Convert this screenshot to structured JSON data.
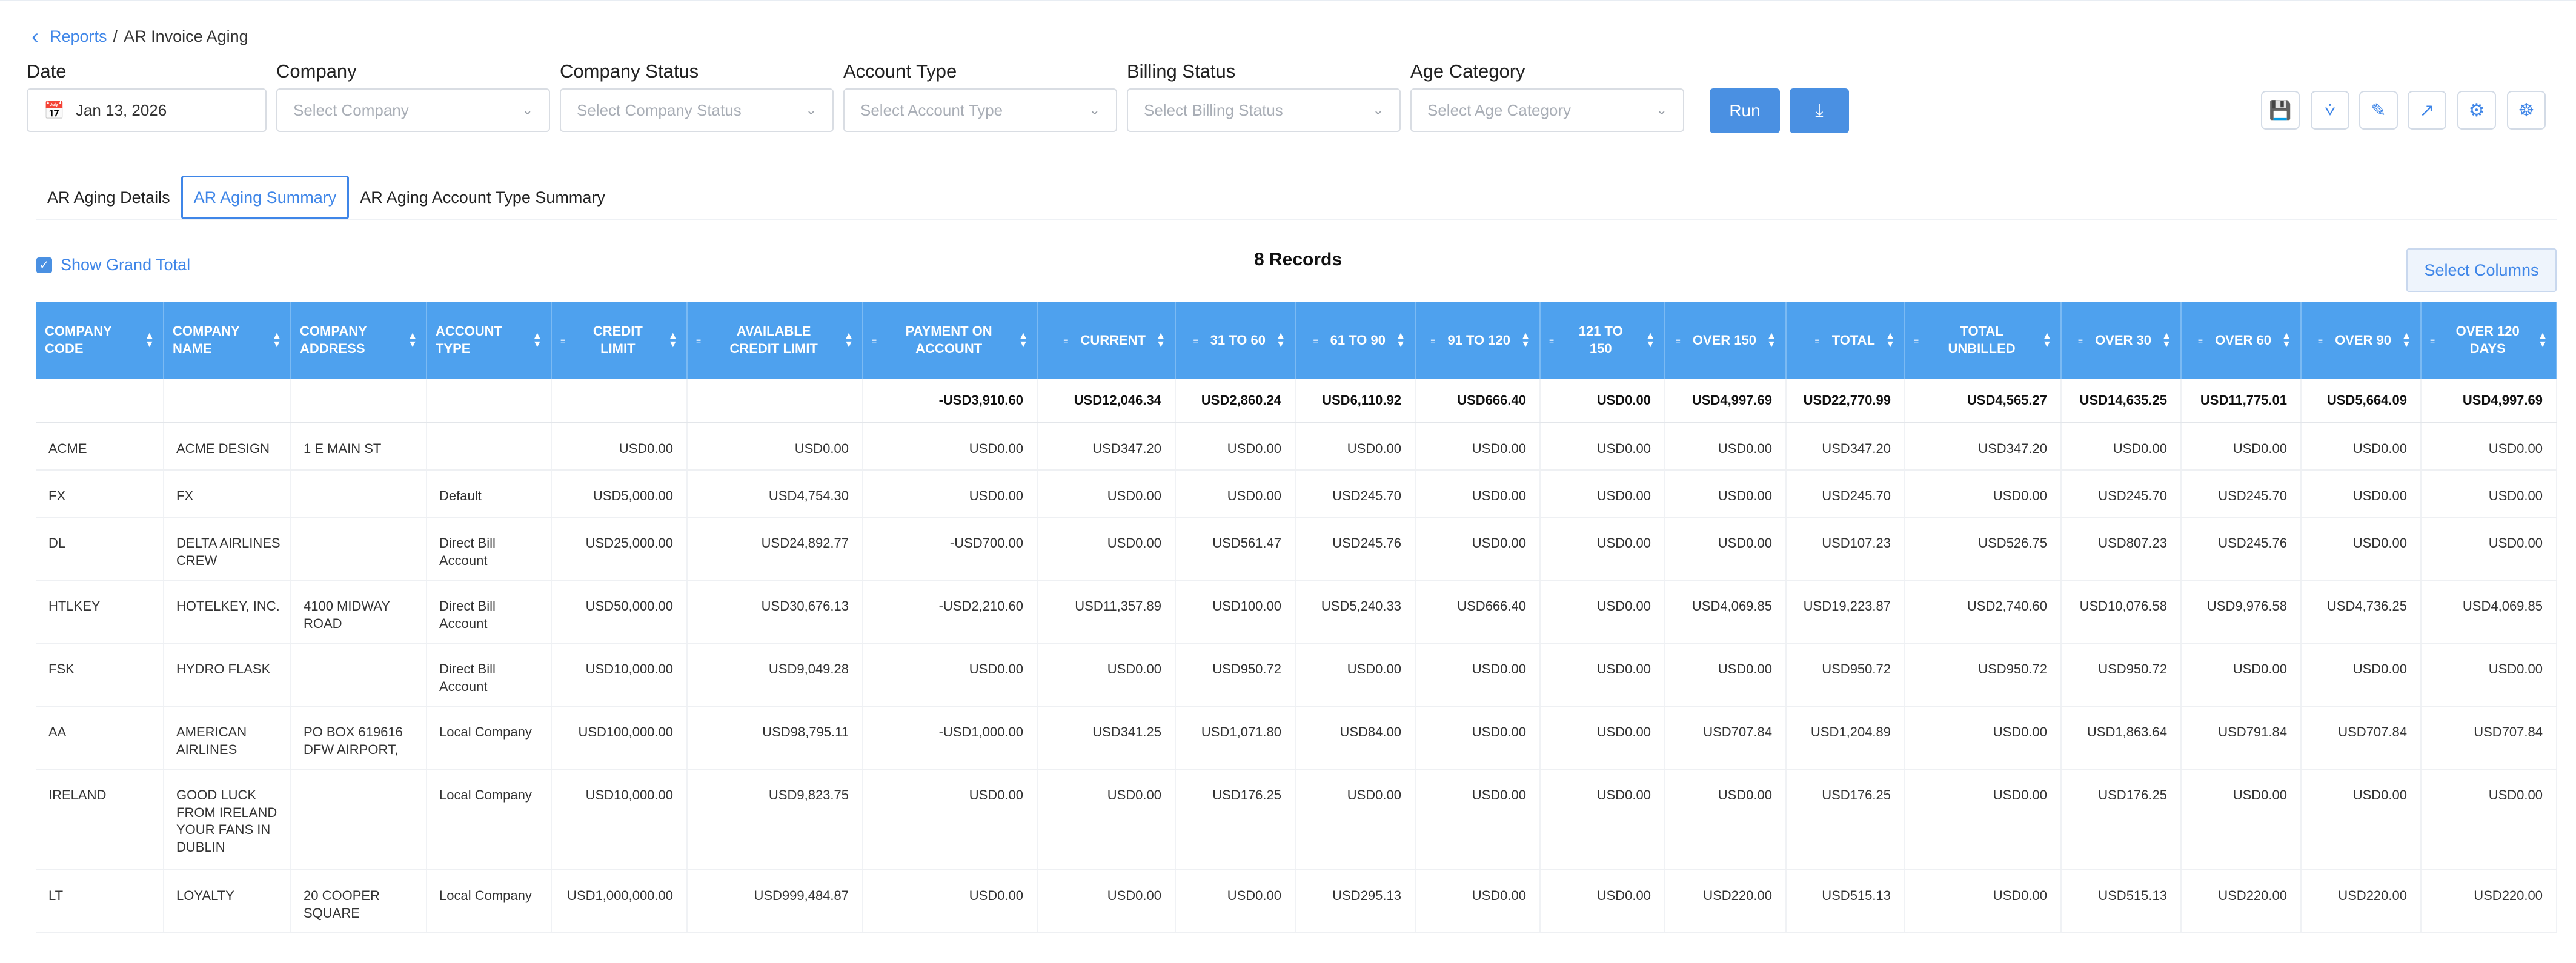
{
  "breadcrumb": {
    "parent": "Reports",
    "separator": "/",
    "current": "AR Invoice Aging"
  },
  "filters": {
    "date": {
      "label": "Date",
      "value": "Jan 13, 2026"
    },
    "company": {
      "label": "Company",
      "placeholder": "Select Company"
    },
    "company_status": {
      "label": "Company Status",
      "placeholder": "Select Company Status"
    },
    "account_type": {
      "label": "Account Type",
      "placeholder": "Select Account Type"
    },
    "billing_status": {
      "label": "Billing Status",
      "placeholder": "Select Billing Status"
    },
    "age_category": {
      "label": "Age Category",
      "placeholder": "Select Age Category"
    }
  },
  "buttons": {
    "run": "Run",
    "download_icon": "download-icon"
  },
  "toolbar_icons": [
    "save-icon",
    "filter-icon",
    "edit-icon",
    "export-icon",
    "settings-icon",
    "gear-settings-icon"
  ],
  "tabs": [
    "AR Aging Details",
    "AR Aging Summary",
    "AR Aging Account Type Summary"
  ],
  "active_tab": 1,
  "show_grand_total": {
    "label": "Show Grand Total",
    "checked": true
  },
  "records_label": "8 Records",
  "select_columns_label": "Select Columns",
  "colors": {
    "accent": "#4a90e2",
    "header": "#4ea1ee"
  },
  "table": {
    "columns": [
      "COMPANY CODE",
      "COMPANY NAME",
      "COMPANY ADDRESS",
      "ACCOUNT TYPE",
      "CREDIT LIMIT",
      "AVAILABLE CREDIT LIMIT",
      "PAYMENT ON ACCOUNT",
      "CURRENT",
      "31 TO 60",
      "61 TO 90",
      "91 TO 120",
      "121 TO 150",
      "OVER 150",
      "TOTAL",
      "TOTAL UNBILLED",
      "OVER 30",
      "OVER 60",
      "OVER 90",
      "OVER 120 DAYS"
    ],
    "grand_total": [
      "",
      "",
      "",
      "",
      "",
      "",
      "-USD3,910.60",
      "USD12,046.34",
      "USD2,860.24",
      "USD6,110.92",
      "USD666.40",
      "USD0.00",
      "USD4,997.69",
      "USD22,770.99",
      "USD4,565.27",
      "USD14,635.25",
      "USD11,775.01",
      "USD5,664.09",
      "USD4,997.69"
    ],
    "rows": [
      [
        "ACME",
        "ACME DESIGN",
        "1 E MAIN ST",
        "",
        "USD0.00",
        "USD0.00",
        "USD0.00",
        "USD347.20",
        "USD0.00",
        "USD0.00",
        "USD0.00",
        "USD0.00",
        "USD0.00",
        "USD347.20",
        "USD347.20",
        "USD0.00",
        "USD0.00",
        "USD0.00",
        "USD0.00"
      ],
      [
        "FX",
        "FX",
        "",
        "Default",
        "USD5,000.00",
        "USD4,754.30",
        "USD0.00",
        "USD0.00",
        "USD0.00",
        "USD245.70",
        "USD0.00",
        "USD0.00",
        "USD0.00",
        "USD245.70",
        "USD0.00",
        "USD245.70",
        "USD245.70",
        "USD0.00",
        "USD0.00"
      ],
      [
        "DL",
        "DELTA AIRLINES CREW",
        "",
        "Direct Bill Account",
        "USD25,000.00",
        "USD24,892.77",
        "-USD700.00",
        "USD0.00",
        "USD561.47",
        "USD245.76",
        "USD0.00",
        "USD0.00",
        "USD0.00",
        "USD107.23",
        "USD526.75",
        "USD807.23",
        "USD245.76",
        "USD0.00",
        "USD0.00"
      ],
      [
        "HTLKEY",
        "HOTELKEY, INC.",
        "4100 MIDWAY ROAD",
        "Direct Bill Account",
        "USD50,000.00",
        "USD30,676.13",
        "-USD2,210.60",
        "USD11,357.89",
        "USD100.00",
        "USD5,240.33",
        "USD666.40",
        "USD0.00",
        "USD4,069.85",
        "USD19,223.87",
        "USD2,740.60",
        "USD10,076.58",
        "USD9,976.58",
        "USD4,736.25",
        "USD4,069.85"
      ],
      [
        "FSK",
        "HYDRO FLASK",
        "",
        "Direct Bill Account",
        "USD10,000.00",
        "USD9,049.28",
        "USD0.00",
        "USD0.00",
        "USD950.72",
        "USD0.00",
        "USD0.00",
        "USD0.00",
        "USD0.00",
        "USD950.72",
        "USD950.72",
        "USD950.72",
        "USD0.00",
        "USD0.00",
        "USD0.00"
      ],
      [
        "AA",
        "AMERICAN AIRLINES",
        "PO BOX 619616 DFW AIRPORT,",
        "Local Company",
        "USD100,000.00",
        "USD98,795.11",
        "-USD1,000.00",
        "USD341.25",
        "USD1,071.80",
        "USD84.00",
        "USD0.00",
        "USD0.00",
        "USD707.84",
        "USD1,204.89",
        "USD0.00",
        "USD1,863.64",
        "USD791.84",
        "USD707.84",
        "USD707.84"
      ],
      [
        "IRELAND",
        "GOOD LUCK FROM IRELAND YOUR FANS IN DUBLIN",
        "",
        "Local Company",
        "USD10,000.00",
        "USD9,823.75",
        "USD0.00",
        "USD0.00",
        "USD176.25",
        "USD0.00",
        "USD0.00",
        "USD0.00",
        "USD0.00",
        "USD176.25",
        "USD0.00",
        "USD176.25",
        "USD0.00",
        "USD0.00",
        "USD0.00"
      ],
      [
        "LT",
        "LOYALTY",
        "20 COOPER SQUARE",
        "Local Company",
        "USD1,000,000.00",
        "USD999,484.87",
        "USD0.00",
        "USD0.00",
        "USD0.00",
        "USD295.13",
        "USD0.00",
        "USD0.00",
        "USD220.00",
        "USD515.13",
        "USD0.00",
        "USD515.13",
        "USD220.00",
        "USD220.00",
        "USD220.00"
      ]
    ]
  }
}
